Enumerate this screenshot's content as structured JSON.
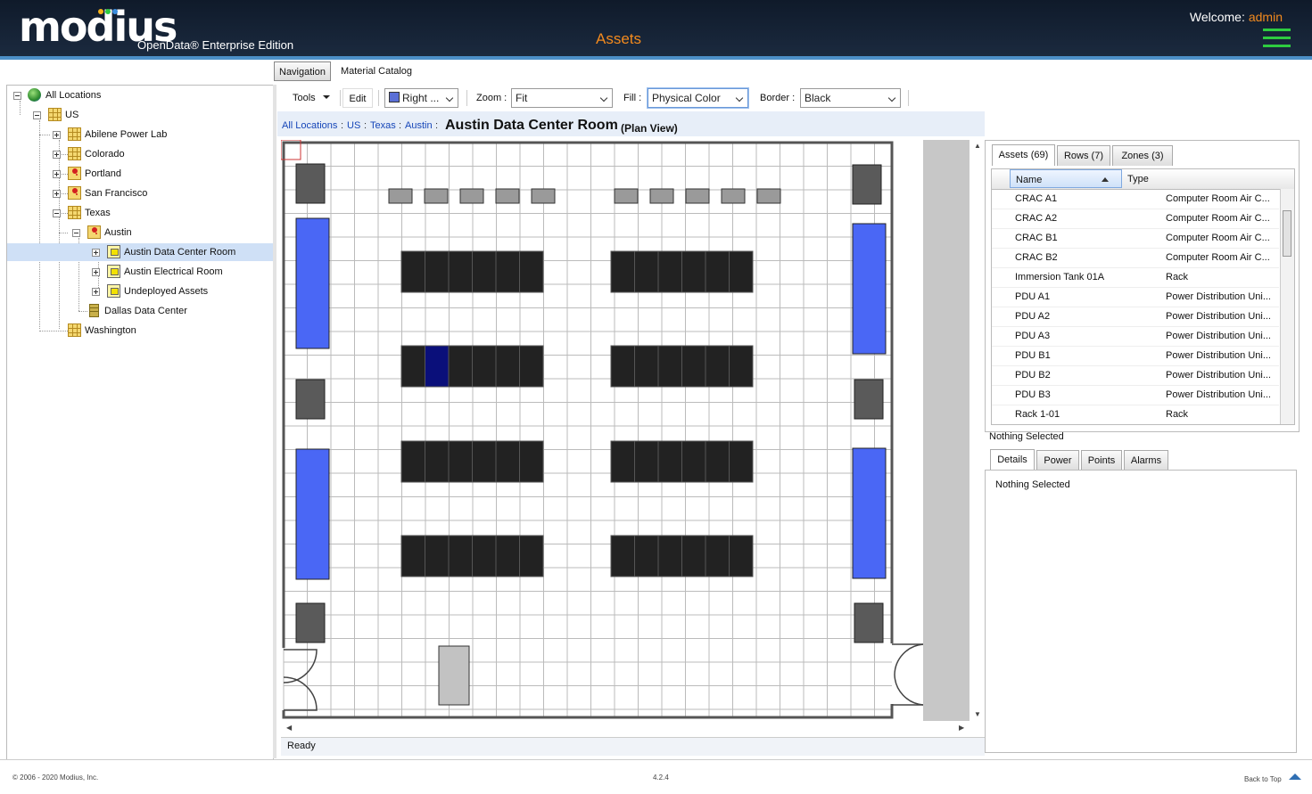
{
  "header": {
    "logo_text": "modius",
    "edition": "OpenData® Enterprise Edition",
    "app_title": "Assets",
    "welcome_label": "Welcome:",
    "user": "admin",
    "logo_dot_colors": [
      "#f6b21a",
      "#2ecc40",
      "#3b8ede",
      "#e03a3a"
    ],
    "accent_color": "#f28a1e",
    "menu_icon": "hamburger-menu-icon"
  },
  "top_tabs": {
    "navigation": "Navigation",
    "material_catalog": "Material Catalog"
  },
  "tree": {
    "nodes": [
      {
        "label": "All Locations",
        "icon": "globe-icon"
      },
      {
        "label": "US",
        "icon": "location-grid-icon"
      },
      {
        "label": "Abilene Power Lab",
        "icon": "location-grid-icon"
      },
      {
        "label": "Colorado",
        "icon": "location-grid-icon"
      },
      {
        "label": "Portland",
        "icon": "map-pin-icon"
      },
      {
        "label": "San Francisco",
        "icon": "map-pin-icon"
      },
      {
        "label": "Texas",
        "icon": "location-grid-icon"
      },
      {
        "label": "Austin",
        "icon": "map-pin-icon"
      },
      {
        "label": "Austin Data Center Room",
        "icon": "room-icon"
      },
      {
        "label": "Austin Electrical Room",
        "icon": "room-icon"
      },
      {
        "label": "Undeployed Assets",
        "icon": "room-icon"
      },
      {
        "label": "Dallas Data Center",
        "icon": "data-center-icon"
      },
      {
        "label": "Washington",
        "icon": "location-grid-icon"
      }
    ],
    "selected": "Austin Data Center Room"
  },
  "toolbar": {
    "tools": "Tools",
    "edit": "Edit",
    "view_select": "Right ...",
    "zoom_label": "Zoom :",
    "zoom_value": "Fit",
    "fill_label": "Fill :",
    "fill_value": "Physical Color",
    "border_label": "Border :",
    "border_value": "Black"
  },
  "breadcrumb": {
    "items": [
      "All Locations",
      "US",
      "Texas",
      "Austin"
    ],
    "title": "Austin Data Center Room",
    "subtitle": "(Plan View)"
  },
  "status": "Ready",
  "assets_tabs": [
    "Assets (69)",
    "Rows (7)",
    "Zones (3)"
  ],
  "assets_grid": {
    "columns": [
      "Name",
      "Type"
    ],
    "rows": [
      {
        "name": "CRAC A1",
        "type": "Computer Room Air C..."
      },
      {
        "name": "CRAC A2",
        "type": "Computer Room Air C..."
      },
      {
        "name": "CRAC B1",
        "type": "Computer Room Air C..."
      },
      {
        "name": "CRAC B2",
        "type": "Computer Room Air C..."
      },
      {
        "name": "Immersion Tank 01A",
        "type": "Rack"
      },
      {
        "name": "PDU A1",
        "type": "Power Distribution Uni..."
      },
      {
        "name": "PDU A2",
        "type": "Power Distribution Uni..."
      },
      {
        "name": "PDU A3",
        "type": "Power Distribution Uni..."
      },
      {
        "name": "PDU B1",
        "type": "Power Distribution Uni..."
      },
      {
        "name": "PDU B2",
        "type": "Power Distribution Uni..."
      },
      {
        "name": "PDU B3",
        "type": "Power Distribution Uni..."
      },
      {
        "name": "Rack 1-01",
        "type": "Rack"
      }
    ]
  },
  "selection_text": "Nothing Selected",
  "detail_tabs": [
    "Details",
    "Power",
    "Points",
    "Alarms"
  ],
  "details_text": "Nothing Selected",
  "footer": {
    "copyright": "© 2006 - 2020 Modius, Inc.",
    "version": "4.2.4",
    "back_to_top": "Back to Top"
  },
  "plan_colors": {
    "crac": "#4a67f5",
    "rack": "#222222",
    "selected_rack": "#0a0f7a",
    "pdu": "#5a5a5a",
    "tile": "#9a9a9a",
    "tank": "#c2c2c2"
  }
}
